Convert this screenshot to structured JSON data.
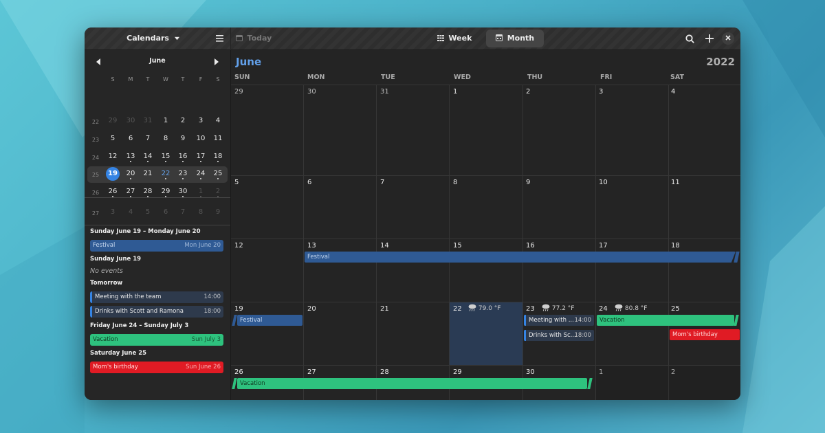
{
  "colors": {
    "accent": "#3584e4",
    "festival": "#2f5a94",
    "vacation": "#2ec27e",
    "birthday": "#e01b24",
    "month_title": "#62a0ea"
  },
  "sidebar_header": {
    "calendars_label": "Calendars",
    "calendars_icon": "chevron-down-icon",
    "menu_icon": "hamburger-menu-icon"
  },
  "main_header": {
    "today_label": "Today",
    "week_label": "Week",
    "month_label": "Month",
    "search_icon": "search-icon",
    "add_icon": "plus-icon",
    "close_icon": "close-icon"
  },
  "mini_calendar": {
    "month": "June",
    "prev_icon": "chevron-left-icon",
    "next_icon": "chevron-right-icon",
    "weekdays": [
      "S",
      "M",
      "T",
      "W",
      "T",
      "F",
      "S"
    ],
    "weeks": [
      {
        "num": "22",
        "days": [
          "29",
          "30",
          "31",
          "1",
          "2",
          "3",
          "4"
        ]
      },
      {
        "num": "23",
        "days": [
          "5",
          "6",
          "7",
          "8",
          "9",
          "10",
          "11"
        ]
      },
      {
        "num": "24",
        "days": [
          "12",
          "13",
          "14",
          "15",
          "16",
          "17",
          "18"
        ]
      },
      {
        "num": "25",
        "days": [
          "19",
          "20",
          "21",
          "22",
          "23",
          "24",
          "25"
        ]
      },
      {
        "num": "26",
        "days": [
          "26",
          "27",
          "28",
          "29",
          "30",
          "1",
          "2"
        ]
      },
      {
        "num": "27",
        "days": [
          "3",
          "4",
          "5",
          "6",
          "7",
          "8",
          "9"
        ]
      }
    ],
    "selected_day": "19"
  },
  "agenda": {
    "section1": "Sunday June 19 – Monday June 20",
    "festival_title": "Festival",
    "festival_end": "Mon June 20",
    "section2": "Sunday June 19",
    "no_events": "No events",
    "section3": "Tomorrow",
    "meeting_title": "Meeting with the team",
    "meeting_time": "14:00",
    "drinks_title": "Drinks with Scott and Ramona",
    "drinks_time": "18:00",
    "section4": "Friday June 24 – Sunday July  3",
    "vacation_title": "Vacation",
    "vacation_end": "Sun July  3",
    "section5": "Saturday June 25",
    "birthday_title": "Mom's birthday",
    "birthday_end": "Sun June 26"
  },
  "month_view": {
    "month": "June",
    "year": "2022",
    "weekdays": [
      "SUN",
      "MON",
      "TUE",
      "WED",
      "THU",
      "FRI",
      "SAT"
    ],
    "weeks": [
      [
        "29",
        "30",
        "31",
        "1",
        "2",
        "3",
        "4"
      ],
      [
        "5",
        "6",
        "7",
        "8",
        "9",
        "10",
        "11"
      ],
      [
        "12",
        "13",
        "14",
        "15",
        "16",
        "17",
        "18"
      ],
      [
        "19",
        "20",
        "21",
        "22",
        "23",
        "24",
        "25"
      ],
      [
        "26",
        "27",
        "28",
        "29",
        "30",
        "1",
        "2"
      ]
    ],
    "weather": {
      "wed22": "79.0 °F",
      "thu23": "77.2 °F",
      "fri24": "80.8 °F",
      "icon": "rain-cloud-icon"
    },
    "events": {
      "festival": "Festival",
      "meeting": "Meeting with ...",
      "meeting_time": "14:00",
      "drinks": "Drinks with Sc...",
      "drinks_time": "18:00",
      "vacation": "Vacation",
      "birthday": "Mom's birthday"
    }
  }
}
